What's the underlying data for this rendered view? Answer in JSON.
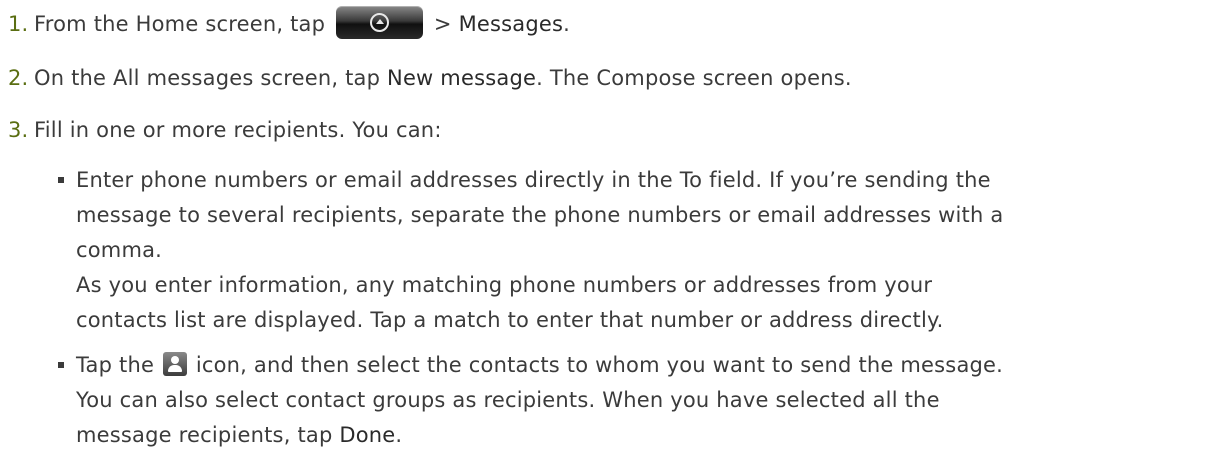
{
  "steps": [
    {
      "number": "1.",
      "text_before": "From the Home screen, tap",
      "icon": "all-apps-button-icon",
      "text_after": " > ",
      "term": "Messages",
      "text_end": "."
    },
    {
      "number": "2.",
      "text_before": "On the All messages screen, tap ",
      "term": "New message",
      "text_after": ". The Compose screen opens."
    },
    {
      "number": "3.",
      "text": "Fill in one or more recipients. You can:"
    }
  ],
  "bullets": [
    {
      "lines": [
        "Enter phone numbers or email addresses directly in the To field. If you’re sending the",
        "message to several recipients, separate the phone numbers or email addresses with a",
        "comma.",
        "As you enter information, any matching phone numbers or addresses from your",
        "contacts list are displayed. Tap a match to enter that number or address directly."
      ]
    },
    {
      "line1_before": "Tap the ",
      "icon": "contacts-icon",
      "line1_after": " icon, and then select the contacts to whom you want to send the message.",
      "line2": "You can also select contact groups as recipients. When you have selected all the",
      "line3_before": "message recipients, tap ",
      "term": "Done",
      "line3_after": "."
    }
  ]
}
